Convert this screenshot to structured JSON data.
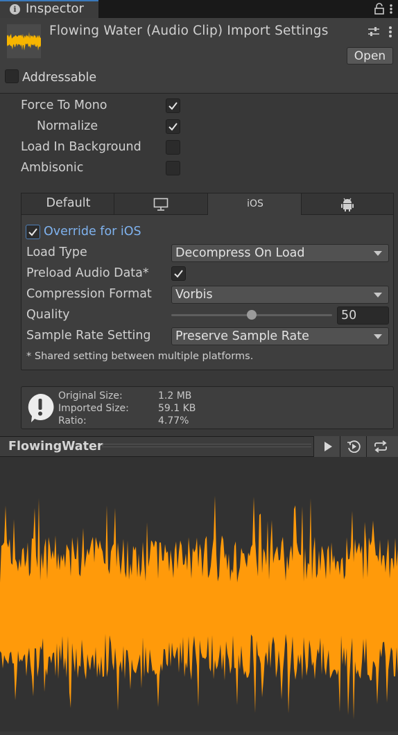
{
  "window": {
    "tab_title": "Inspector",
    "icons": {
      "info": "info-icon",
      "lock": "lock-icon",
      "menu": "kebab-menu-icon"
    }
  },
  "header": {
    "title": "Flowing Water (Audio Clip) Import Settings",
    "open_label": "Open",
    "addressable_label": "Addressable",
    "addressable_checked": false,
    "icons": {
      "thumbnail": "audio-waveform-thumbnail",
      "presets": "presets-icon",
      "more": "kebab-menu-icon"
    }
  },
  "settings": {
    "force_to_mono": {
      "label": "Force To Mono",
      "checked": true
    },
    "normalize": {
      "label": "Normalize",
      "checked": true
    },
    "load_in_background": {
      "label": "Load In Background",
      "checked": false
    },
    "ambisonic": {
      "label": "Ambisonic",
      "checked": false
    }
  },
  "platform_tabs": [
    {
      "label": "Default",
      "icon": null,
      "selected": false
    },
    {
      "label": "",
      "icon": "monitor-icon",
      "selected": false
    },
    {
      "label": "iOS",
      "icon": null,
      "selected": true
    },
    {
      "label": "",
      "icon": "android-icon",
      "selected": false
    }
  ],
  "platform": {
    "override_label": "Override for iOS",
    "override_checked": true,
    "load_type_label": "Load Type",
    "load_type_value": "Decompress On Load",
    "preload_label": "Preload Audio Data*",
    "preload_checked": true,
    "compression_label": "Compression Format",
    "compression_value": "Vorbis",
    "quality_label": "Quality",
    "quality_value": "50",
    "quality_fraction": 0.5,
    "sample_rate_label": "Sample Rate Setting",
    "sample_rate_value": "Preserve Sample Rate",
    "footnote": "* Shared setting between multiple platforms."
  },
  "info": {
    "icon": "warning-speech-icon",
    "original_label": "Original Size:",
    "original_value": "1.2 MB",
    "imported_label": "Imported Size:",
    "imported_value": "59.1 KB",
    "ratio_label": "Ratio:",
    "ratio_value": "4.77%"
  },
  "preview": {
    "title": "FlowingWater",
    "icons": {
      "play": "play-icon",
      "autoplay": "autoplay-icon",
      "loop": "loop-icon"
    }
  },
  "colors": {
    "accent": "#3a79bb",
    "link_blue": "#7fb2ee",
    "waveform": "#ff9a0a",
    "background": "#383838"
  }
}
